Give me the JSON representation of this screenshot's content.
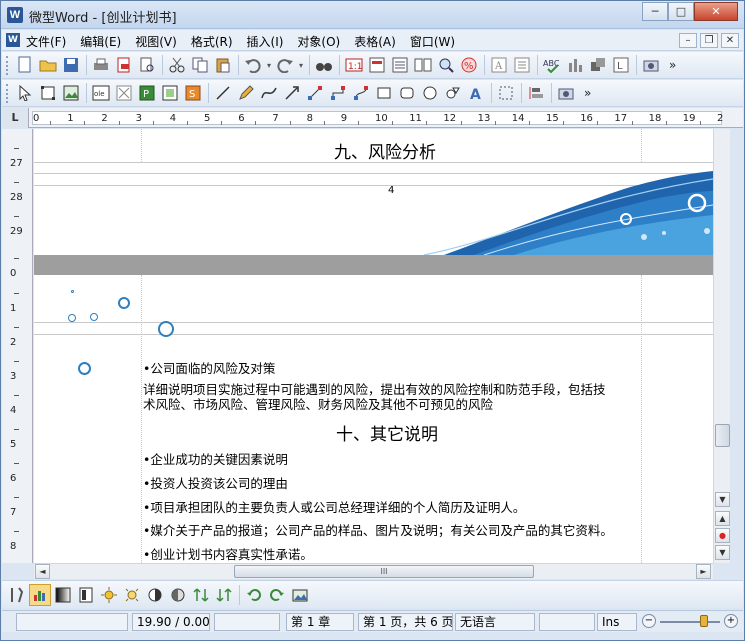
{
  "window": {
    "title": "微型Word - [创业计划书]",
    "app_icon_letter": "W",
    "buttons": {
      "minimize": "─",
      "maximize": "□",
      "close": "✕"
    }
  },
  "menubar": {
    "items": [
      "文件(F)",
      "编辑(E)",
      "视图(V)",
      "格式(R)",
      "插入(I)",
      "对象(O)",
      "表格(A)",
      "窗口(W)"
    ],
    "mdi_buttons": {
      "minimize": "–",
      "restore": "❐",
      "close": "✕"
    }
  },
  "toolbar_more": "»",
  "ruler": {
    "corner": "L",
    "labels": [
      "0",
      "1",
      "2",
      "3",
      "4",
      "5",
      "6",
      "7",
      "8",
      "9",
      "10",
      "11",
      "12",
      "13",
      "14",
      "15",
      "16",
      "17",
      "18",
      "19",
      "2"
    ]
  },
  "vruler": {
    "labels": [
      "27",
      "28",
      "29",
      "0",
      "1",
      "2",
      "3",
      "4",
      "5",
      "6",
      "7",
      "8"
    ]
  },
  "document": {
    "heading_top": "九、风险分析",
    "page_number": "4",
    "risk_bullet": "•公司面临的风险及对策",
    "risk_para_line1": "详细说明项目实施过程中可能遇到的风险，提出有效的风险控制和防范手段，包括技",
    "risk_para_line2": "术风险、市场风险、管理风险、财务风险及其他不可预见的风险",
    "heading_other": "十、其它说明",
    "bullets": [
      "•企业成功的关键因素说明",
      "•投资人投资该公司的理由",
      "•项目承担团队的主要负责人或公司总经理详细的个人简历及证明人。",
      "•媒介关于产品的报道；公司产品的样品、图片及说明；有关公司及产品的其它资料。",
      "•创业计划书内容真实性承诺。"
    ]
  },
  "scroll": {
    "up": "▲",
    "down": "▼",
    "left": "◄",
    "right": "►",
    "grip": "III",
    "prev_page": "▲",
    "browse": "●",
    "next_page": "▼"
  },
  "statusbar": {
    "position": "19.90 / 0.00",
    "chapter": "第 1 章",
    "page": "第 1 页，共 6 页",
    "language": "无语言",
    "mode": "Ins",
    "zoom_minus": "−",
    "zoom_plus": "+"
  },
  "colors": {
    "accent_blue": "#2f7fbd",
    "title_bar": "#c3d6ee",
    "page_gap": "#9e9e9e"
  }
}
